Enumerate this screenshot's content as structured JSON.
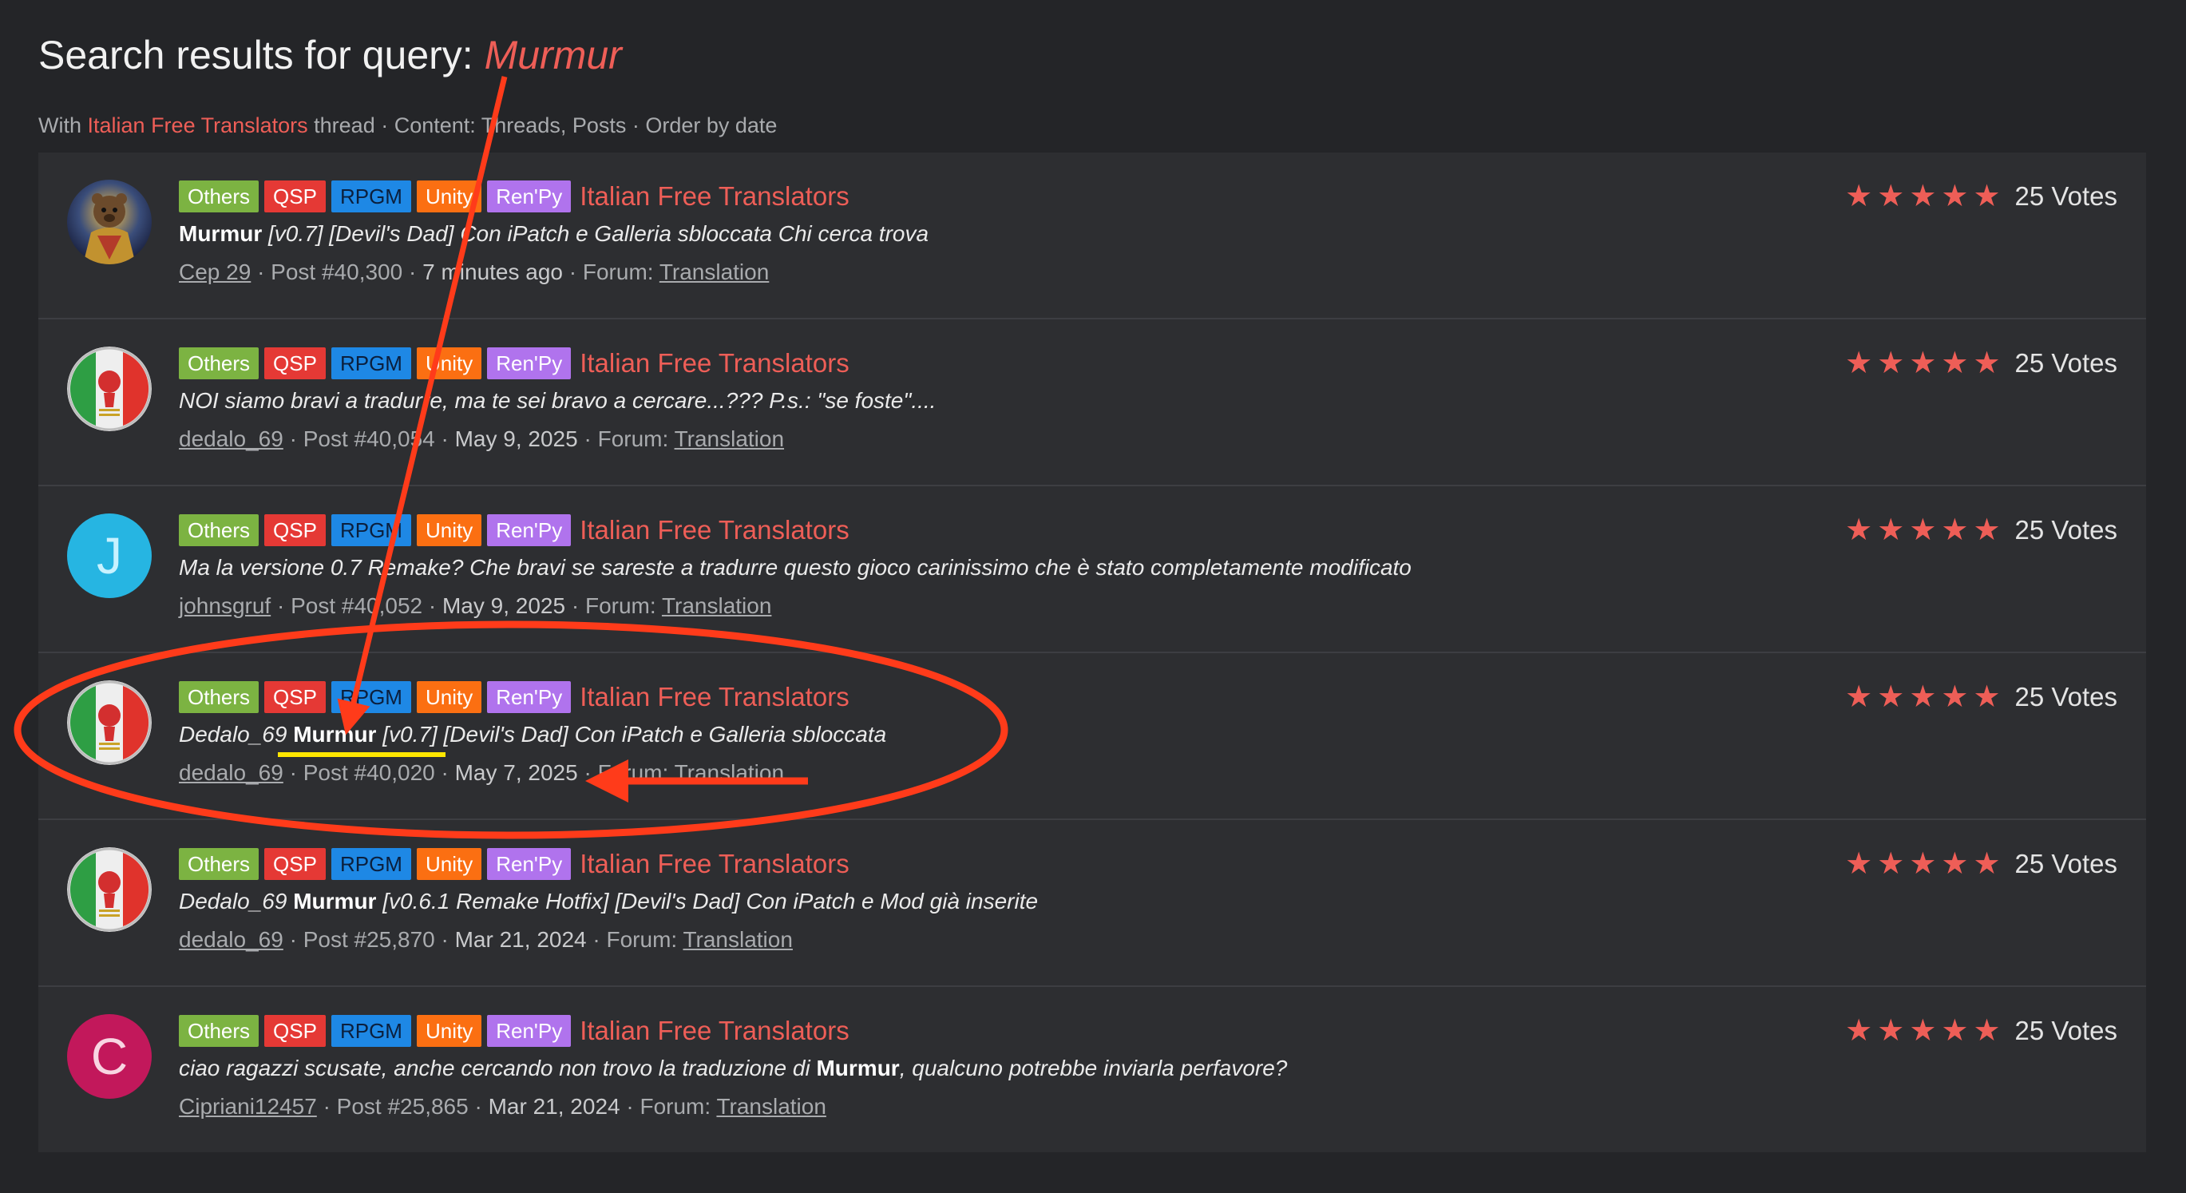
{
  "header": {
    "title_prefix": "Search results for query:",
    "query": "Murmur"
  },
  "filters": {
    "prefix": "With",
    "thread_name": "Italian Free Translators",
    "suffix": "thread · Content: Threads, Posts · Order by date"
  },
  "tags": {
    "others": "Others",
    "qsp": "QSP",
    "rpgm": "RPGM",
    "unity": "Unity",
    "renpy": "Ren'Py"
  },
  "thread_title": "Italian Free Translators",
  "rating": {
    "stars": 5,
    "votes_label": "25 Votes"
  },
  "meta_labels": {
    "forum_prefix": "· Forum:",
    "forum_name": "Translation"
  },
  "results": [
    {
      "avatar": "bear-warrior-avatar",
      "snippet_before": "",
      "snippet_bold": "Murmur",
      "snippet_after": " [v0.7] [Devil's Dad] Con iPatch e Galleria sbloccata Chi cerca trova",
      "user": "Cep 29",
      "post": "· Post #40,300 ·",
      "date": "7 minutes ago"
    },
    {
      "avatar": "italian-flag-avatar",
      "snippet_before": "NOI siamo bravi a tradurre, ma te sei bravo a cercare...??? P.s.: \"se foste\"....",
      "snippet_bold": "",
      "snippet_after": "",
      "user": "dedalo_69",
      "post": "· Post #40,054 ·",
      "date": "May 9, 2025"
    },
    {
      "avatar": "J",
      "snippet_before": "Ma la versione 0.7 Remake? Che bravi se sareste a tradurre questo gioco carinissimo che è stato completamente modificato",
      "snippet_bold": "",
      "snippet_after": "",
      "user": "johnsgruf",
      "post": "· Post #40,052 ·",
      "date": "May 9, 2025"
    },
    {
      "avatar": "italian-flag-avatar",
      "snippet_before": "Dedalo_69 ",
      "snippet_bold": "Murmur",
      "snippet_after": " [v0.7] [Devil's Dad] Con iPatch e Galleria sbloccata",
      "user": "dedalo_69",
      "post": "· Post #40,020 ·",
      "date": "May 7, 2025"
    },
    {
      "avatar": "italian-flag-avatar",
      "snippet_before": "Dedalo_69 ",
      "snippet_bold": "Murmur",
      "snippet_after": " [v0.6.1 Remake Hotfix] [Devil's Dad] Con iPatch e Mod già inserite",
      "user": "dedalo_69",
      "post": "· Post #25,870 ·",
      "date": "Mar 21, 2024"
    },
    {
      "avatar": "C",
      "snippet_before": "ciao ragazzi scusate, anche cercando non trovo la traduzione di ",
      "snippet_bold": "Murmur",
      "snippet_after": ", qualcuno potrebbe inviarla perfavore?",
      "user": "Cipriani12457",
      "post": "· Post #25,865 ·",
      "date": "Mar 21, 2024"
    }
  ],
  "colors": {
    "background": "#242528",
    "panel": "#2d2e31",
    "accent": "#ee5e57",
    "annotation_red": "#ff3b1a",
    "annotation_yellow": "#ffe600"
  }
}
